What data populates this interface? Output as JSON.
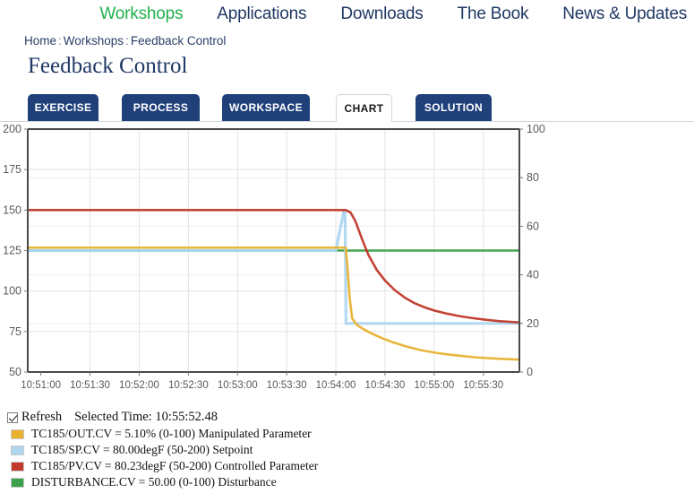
{
  "topnav": {
    "items": [
      {
        "label": "Workshops",
        "active": true
      },
      {
        "label": "Applications",
        "active": false
      },
      {
        "label": "Downloads",
        "active": false
      },
      {
        "label": "The Book",
        "active": false
      },
      {
        "label": "News & Updates",
        "active": false
      }
    ]
  },
  "breadcrumb": {
    "home": "Home",
    "section": "Workshops",
    "page": "Feedback Control",
    "separator": ":"
  },
  "page": {
    "title": "Feedback Control"
  },
  "tabs": [
    {
      "label": "EXERCISE",
      "active": false
    },
    {
      "label": "PROCESS",
      "active": false
    },
    {
      "label": "WORKSPACE",
      "active": false
    },
    {
      "label": "CHART",
      "active": true
    },
    {
      "label": "SOLUTION",
      "active": false
    }
  ],
  "controls": {
    "refresh_label": "Refresh",
    "refresh_checked": true,
    "selected_time_label": "Selected Time:",
    "selected_time_value": "10:55:52.48"
  },
  "legend": [
    {
      "swatch": "#e8b230",
      "text": "TC185/OUT.CV = 5.10% (0-100) Manipulated Parameter"
    },
    {
      "swatch": "#aed6f1",
      "text": "TC185/SP.CV = 80.00degF (50-200) Setpoint"
    },
    {
      "swatch": "#c0392b",
      "text": "TC185/PV.CV = 80.23degF (50-200) Controlled Parameter"
    },
    {
      "swatch": "#3ba14a",
      "text": "DISTURBANCE.CV = 50.00 (0-100) Disturbance"
    }
  ],
  "chart_data": {
    "type": "line",
    "title": "",
    "xlabel": "",
    "ylabel": "",
    "grid": true,
    "legend_position": "below",
    "x_tick_labels": [
      "10:51:00",
      "10:51:30",
      "10:52:00",
      "10:52:30",
      "10:53:00",
      "10:53:30",
      "10:54:00",
      "10:54:30",
      "10:55:00",
      "10:55:30"
    ],
    "x_tick_seconds": [
      0,
      30,
      60,
      90,
      120,
      150,
      180,
      210,
      240,
      270
    ],
    "xlim_seconds": [
      -8,
      292
    ],
    "left_axis": {
      "label": "",
      "ticks": [
        50,
        75,
        100,
        125,
        150,
        175,
        200
      ],
      "ylim": [
        50,
        200
      ]
    },
    "right_axis": {
      "label": "",
      "ticks": [
        0,
        20,
        40,
        60,
        80,
        100
      ],
      "ylim": [
        0,
        100
      ]
    },
    "step_time_seconds": 186,
    "series": [
      {
        "name": "TC185/PV.CV",
        "label": "Controlled Parameter",
        "axis": "left",
        "color": "#c0392b",
        "units": "degF",
        "range": [
          50,
          200
        ],
        "final_value": 80.23,
        "x": [
          -8,
          60,
          120,
          180,
          186,
          189,
          192,
          196,
          200,
          205,
          210,
          216,
          222,
          228,
          234,
          240,
          248,
          256,
          264,
          272,
          280,
          292
        ],
        "y": [
          150,
          150,
          150,
          150,
          150.0,
          148.5,
          143.0,
          132.0,
          122.0,
          113.0,
          106.5,
          100.5,
          96.0,
          92.5,
          90.0,
          88.0,
          86.0,
          84.4,
          83.2,
          82.2,
          81.4,
          80.6
        ]
      },
      {
        "name": "TC185/SP.CV",
        "label": "Setpoint",
        "axis": "left",
        "color": "#aed6f1",
        "units": "degF",
        "range": [
          50,
          200
        ],
        "final_value": 80.0,
        "x": [
          -8,
          100,
          180,
          185.0,
          185.6,
          186.2,
          250,
          292
        ],
        "y": [
          125,
          125,
          125,
          150,
          150,
          80,
          80,
          80
        ]
      },
      {
        "name": "TC185/OUT.CV",
        "label": "Manipulated Parameter",
        "axis": "right",
        "color": "#e8b230",
        "units": "%",
        "range": [
          0,
          100
        ],
        "final_value": 5.1,
        "x": [
          -8,
          60,
          120,
          180,
          186,
          187,
          188.5,
          190,
          193,
          197,
          202,
          208,
          215,
          223,
          232,
          242,
          254,
          266,
          278,
          292
        ],
        "y": [
          51.2,
          51.2,
          51.2,
          51.2,
          51.2,
          44.0,
          30.0,
          22.0,
          19.3,
          17.6,
          15.8,
          14.0,
          12.2,
          10.5,
          9.0,
          7.8,
          6.8,
          6.0,
          5.5,
          5.1
        ]
      },
      {
        "name": "DISTURBANCE.CV",
        "label": "Disturbance",
        "axis": "right",
        "color": "#3ba14a",
        "units": "",
        "range": [
          0,
          100
        ],
        "final_value": 50.0,
        "x": [
          -8,
          292
        ],
        "y": [
          50,
          50
        ]
      }
    ]
  }
}
